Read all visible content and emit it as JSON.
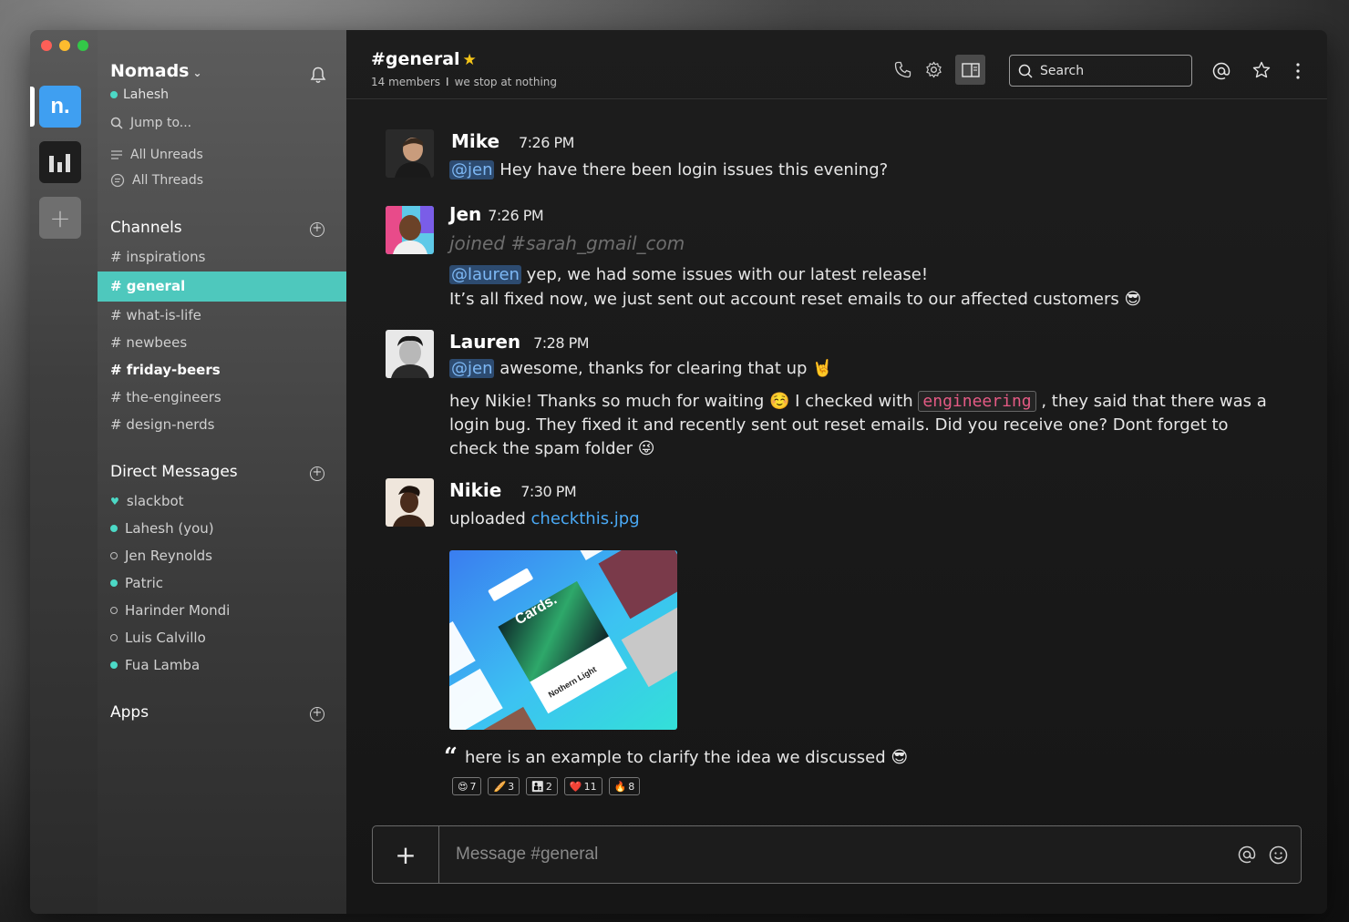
{
  "workspace": {
    "name": "Nomads",
    "caret": "⌄",
    "user": "Lahesh",
    "jump_label": "Jump to...",
    "nomads_tile": "n."
  },
  "nav": {
    "unreads": "All Unreads",
    "threads": "All Threads"
  },
  "channels": {
    "title": "Channels",
    "items": [
      {
        "label": "# inspirations",
        "bold": false
      },
      {
        "label": "# general",
        "active": true
      },
      {
        "label": "# what-is-life",
        "bold": false
      },
      {
        "label": "# newbees",
        "bold": false
      },
      {
        "label": "# friday-beers",
        "bold": true
      },
      {
        "label": "# the-engineers",
        "bold": false
      },
      {
        "label": "# design-nerds",
        "bold": false
      }
    ]
  },
  "dms": {
    "title": "Direct Messages",
    "items": [
      {
        "label": "slackbot",
        "status": "heart"
      },
      {
        "label": "Lahesh (you)",
        "status": "online"
      },
      {
        "label": "Jen Reynolds",
        "status": "offline"
      },
      {
        "label": "Patric",
        "status": "online"
      },
      {
        "label": "Harinder Mondi",
        "status": "offline"
      },
      {
        "label": "Luis Calvillo",
        "status": "offline"
      },
      {
        "label": "Fua Lamba",
        "status": "online"
      }
    ]
  },
  "apps": {
    "title": "Apps"
  },
  "header": {
    "channel": "#general",
    "members": "14 members",
    "separator": "I",
    "topic": "we stop at nothing",
    "search_placeholder": "Search"
  },
  "messages": {
    "mike": {
      "sender": "Mike",
      "time": "7:26 PM",
      "mention": "@jen",
      "text": " Hey have there been login issues this evening?"
    },
    "jen": {
      "sender": "Jen",
      "time": "7:26 PM",
      "joined": "joined #sarah_gmail_com",
      "mention": "@lauren",
      "text1": " yep, we had some issues with our latest release!",
      "text2": "It’s all fixed now, we just sent out account reset emails to our affected customers 😎"
    },
    "lauren": {
      "sender": "Lauren",
      "time": "7:28 PM",
      "mention": "@jen",
      "text1": " awesome, thanks for clearing that up 🤘",
      "para_a": "hey Nikie! Thanks so much for waiting ☺️ I checked with ",
      "code": "engineering",
      "para_b": " , they said that there was a login bug. They fixed it and recently sent out reset emails. Did you receive one? Dont forget to check the spam folder 😜"
    },
    "nikie": {
      "sender": "Nikie",
      "time": "7:30 PM",
      "uploaded": "uploaded ",
      "file": "checkthis.jpg",
      "attachment_title": "Cards.",
      "attachment_caption": "Nothern Light",
      "quote": "here is an example to clarify the idea we discussed 😎"
    }
  },
  "reactions": [
    {
      "emoji": "😍",
      "count": "7"
    },
    {
      "emoji": "🥖",
      "count": "3"
    },
    {
      "emoji": "👨‍👦",
      "count": "2"
    },
    {
      "emoji": "❤️",
      "count": "11"
    },
    {
      "emoji": "🔥",
      "count": "8"
    }
  ],
  "composer": {
    "plus": "+",
    "placeholder": "Message #general"
  },
  "colors": {
    "accent": "#4ec8bd",
    "online": "#4cd9c6",
    "link": "#4aa9f5",
    "mention_bg": "#2d4b70",
    "code_text": "#e45a84",
    "star": "#f5c518"
  }
}
